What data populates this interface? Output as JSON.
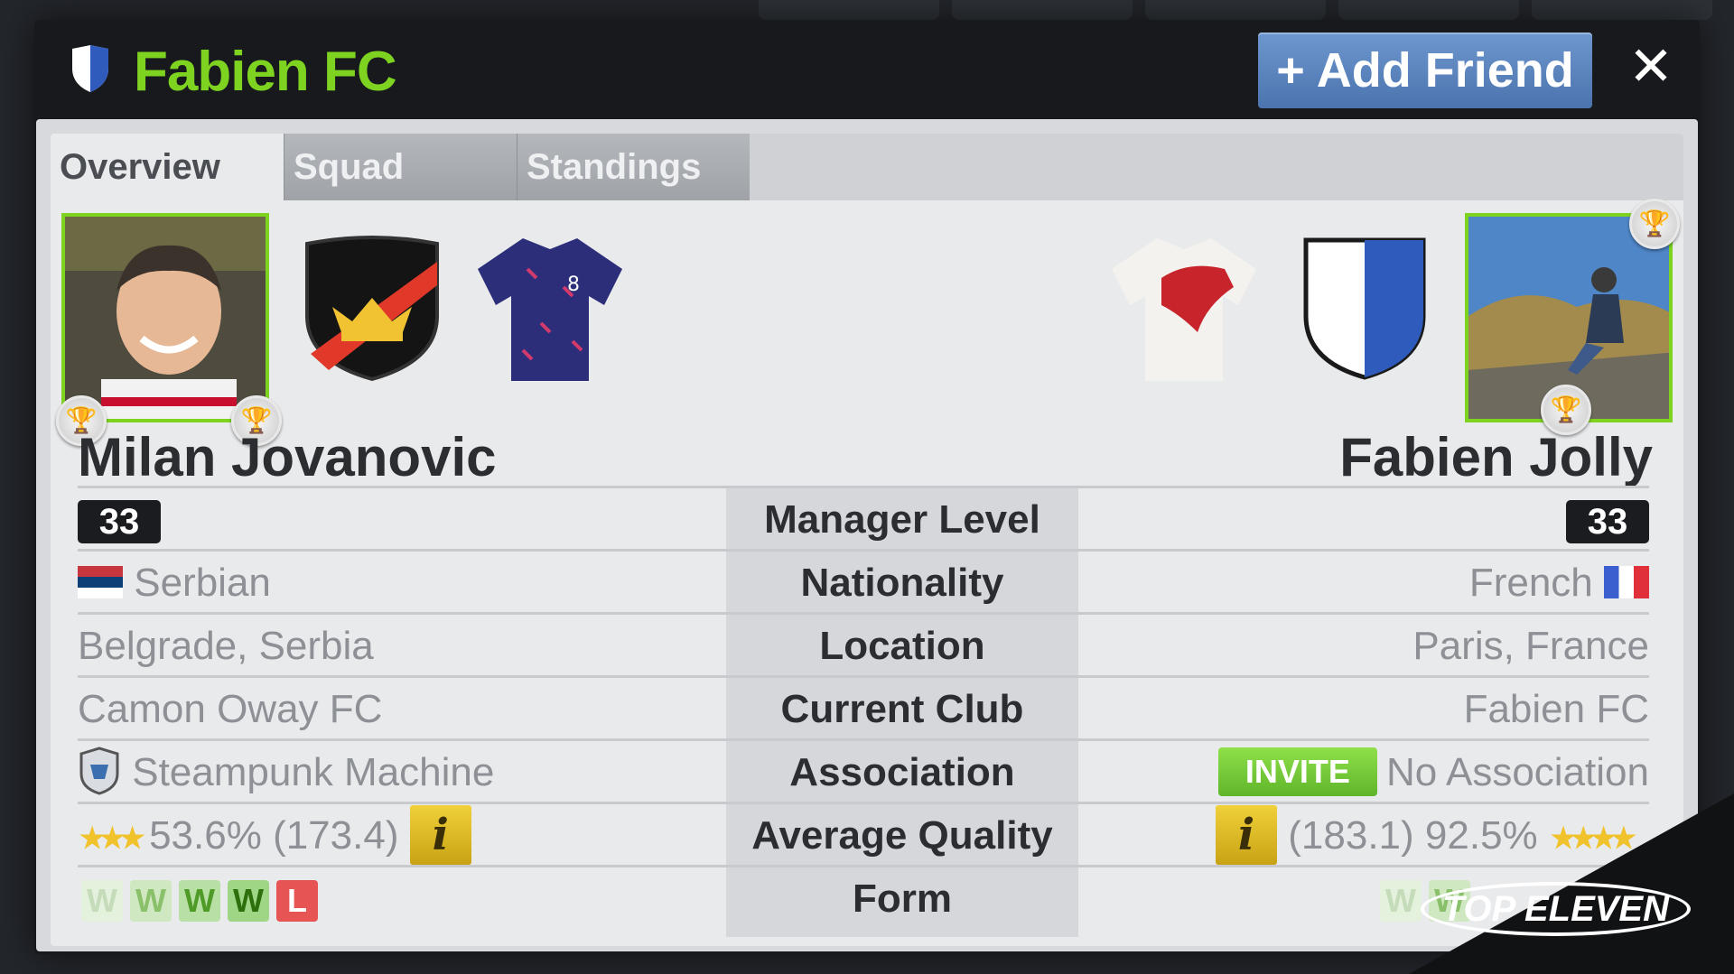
{
  "header": {
    "club_title": "Fabien FC",
    "add_friend_label": "+ Add Friend",
    "close_label": "✕"
  },
  "tabs": [
    {
      "label": "Overview",
      "active": true
    },
    {
      "label": "Squad",
      "active": false
    },
    {
      "label": "Standings",
      "active": false
    }
  ],
  "left_manager": {
    "name": "Milan Jovanovic",
    "level": "33",
    "nationality": "Serbian",
    "location": "Belgrade, Serbia",
    "club": "Camon Oway FC",
    "association": "Steampunk Machine",
    "quality_pct": "53.6%",
    "quality_val": "(173.4)",
    "stars": "★★★",
    "form": [
      "W",
      "W",
      "W",
      "W",
      "L"
    ],
    "badge_colors": {
      "shield": "#111111",
      "sash": "#e0392a",
      "crown": "#f1c232"
    },
    "kit_color": "#2c2e7a"
  },
  "right_manager": {
    "name": "Fabien Jolly",
    "level": "33",
    "nationality": "French",
    "location": "Paris, France",
    "club": "Fabien FC",
    "invite_label": "INVITE",
    "association": "No Association",
    "quality_pct": "92.5%",
    "quality_val": "(183.1)",
    "stars": "★★★★",
    "form": [
      "W",
      "W"
    ],
    "badge_colors": {
      "left": "#ffffff",
      "right": "#2f5bbd"
    },
    "kit_color": "#f4f2ef"
  },
  "row_labels": {
    "level": "Manager Level",
    "nationality": "Nationality",
    "location": "Location",
    "club": "Current Club",
    "association": "Association",
    "quality": "Average Quality",
    "form": "Form"
  },
  "info_icon": "i",
  "watermark": "TOP ELEVEN",
  "colors": {
    "accent_green": "#7ed321",
    "add_friend_blue": "#5a82bc",
    "panel_bg": "#e9eaec"
  }
}
